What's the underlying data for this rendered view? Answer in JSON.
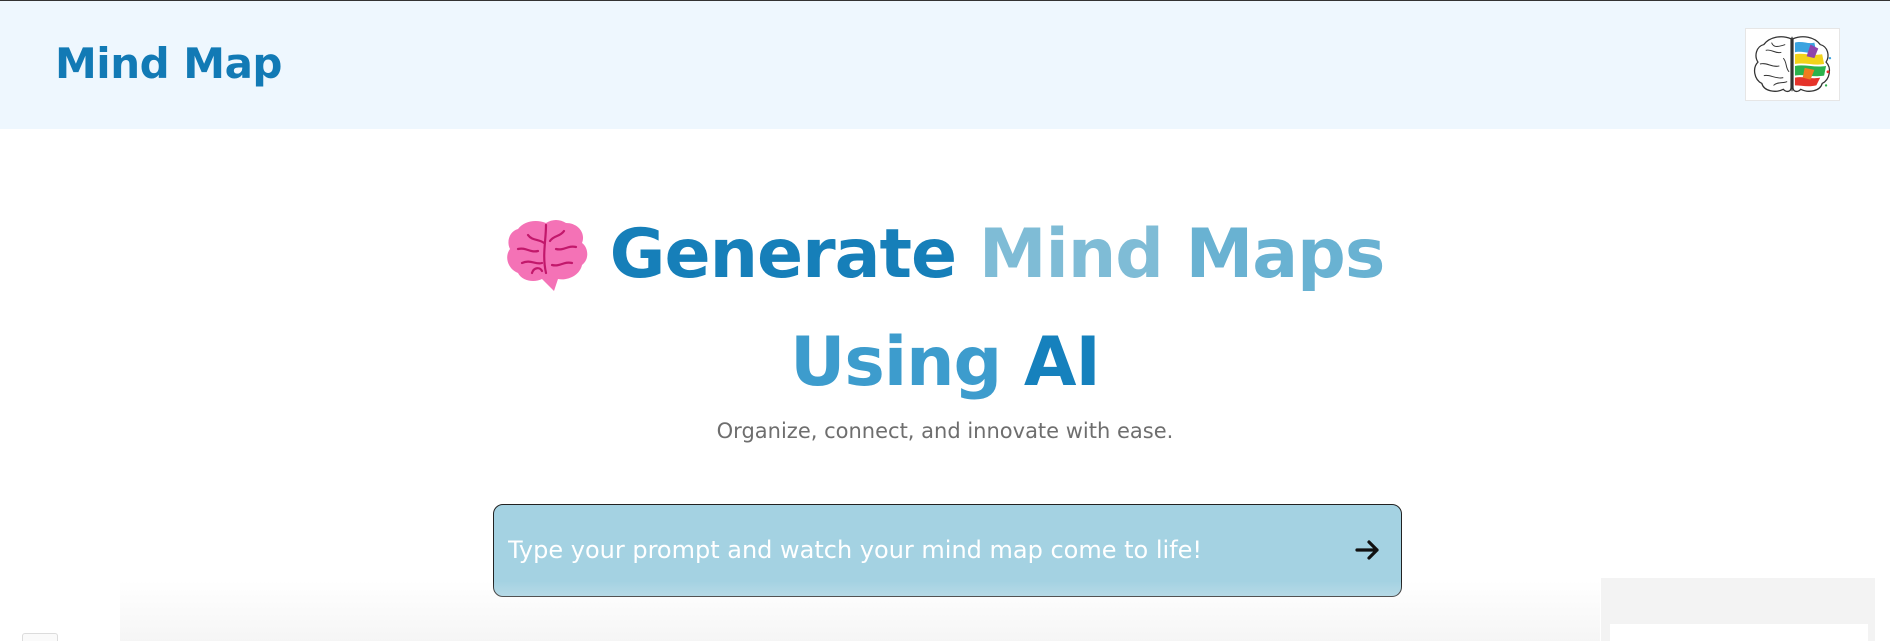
{
  "header": {
    "brand": "Mind Map",
    "logo_icon": "brain-logo-icon"
  },
  "hero": {
    "emoji_icon": "brain-emoji-icon",
    "title_words": [
      "Generate",
      "Mind",
      "Maps",
      "Using",
      "AI"
    ],
    "subtitle": "Organize, connect, and innovate with ease."
  },
  "prompt": {
    "placeholder": "Type your prompt and watch your mind map come to life!",
    "value": "",
    "submit_icon": "arrow-right-icon"
  },
  "colors": {
    "header_bg": "#eef7fe",
    "brand": "#127ab5",
    "prompt_bg": "#a4d2e2",
    "title_dark": "#167fb9",
    "title_light": "#7fbcd6"
  }
}
